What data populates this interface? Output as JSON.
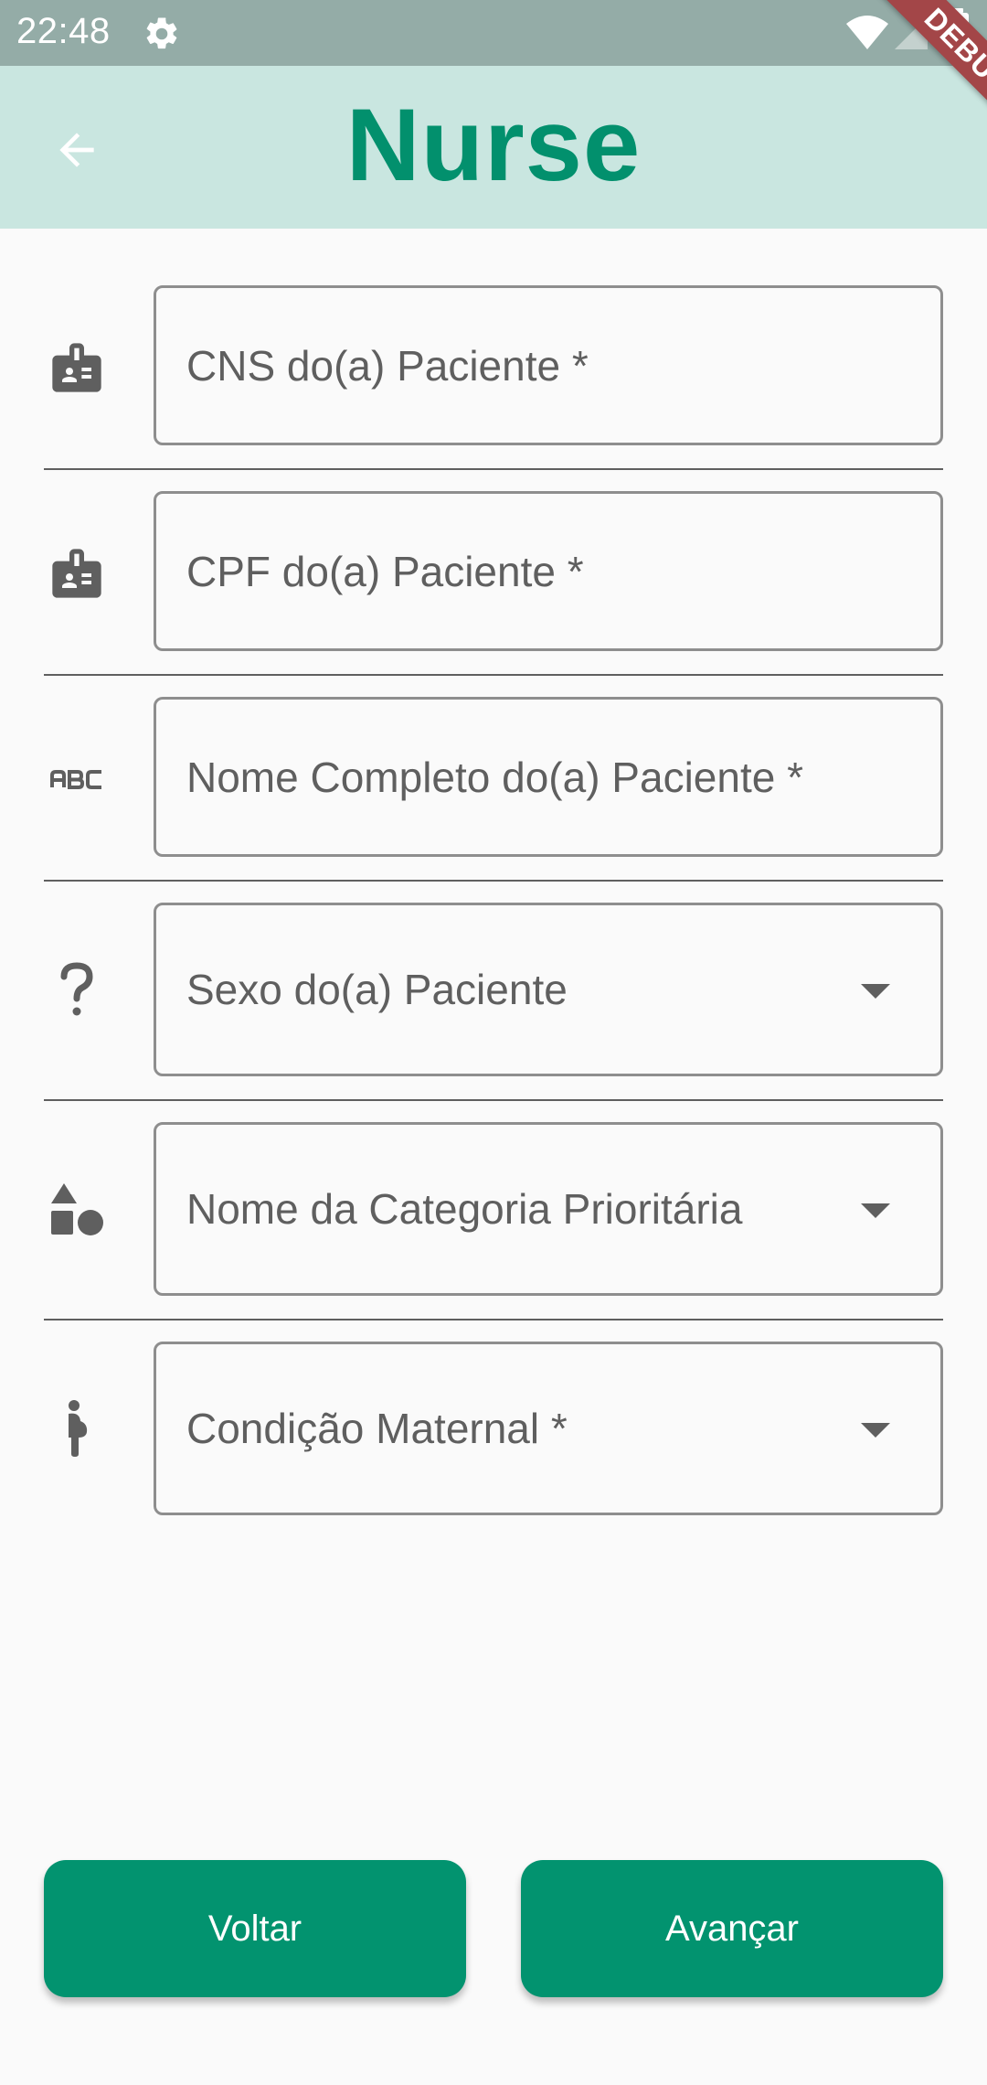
{
  "status_bar": {
    "time": "22:48"
  },
  "app_bar": {
    "title": "Nurse"
  },
  "debug_banner": "DEBUG",
  "form": {
    "cns_placeholder": "CNS do(a) Paciente *",
    "cpf_placeholder": "CPF do(a) Paciente *",
    "name_placeholder": "Nome Completo do(a) Paciente *",
    "sex_select": "Sexo do(a) Paciente",
    "priority_select": "Nome da Categoria Prioritária",
    "maternal_select": "Condição Maternal *"
  },
  "buttons": {
    "back_label": "Voltar",
    "next_label": "Avançar"
  },
  "colors": {
    "accent": "#02936F",
    "app_bar_bg": "#C9E6E0",
    "status_bar_bg": "#94ACA7",
    "debug_ribbon": "#A34648"
  },
  "icons": {
    "status_settings": "gear-icon",
    "status_wifi": "wifi-icon",
    "status_signal": "signal-icon",
    "status_battery": "battery-icon",
    "back": "arrow-back-icon",
    "cns": "badge-icon",
    "cpf": "badge-icon",
    "name": "abc-icon",
    "sex": "question-mark-icon",
    "priority": "category-shapes-icon",
    "maternal": "pregnant-woman-icon"
  }
}
